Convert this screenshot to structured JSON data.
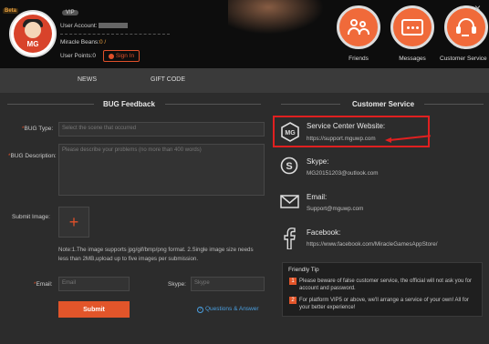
{
  "header": {
    "beta_label": "Beta",
    "vip_label": "VIP",
    "user_account_label": "User Account:",
    "miracle_beans_label": "Miracle Beans:",
    "miracle_beans_value": "0 /",
    "user_points_label": "User Points:",
    "user_points_value": "0",
    "sign_in_label": "Sign In",
    "avatar_text": "MG",
    "buttons": [
      {
        "label": "Friends",
        "icon": "friends-icon"
      },
      {
        "label": "Messages",
        "icon": "messages-icon"
      },
      {
        "label": "Customer Service",
        "icon": "headset-icon"
      }
    ],
    "close_glyph": "×"
  },
  "tabs": [
    {
      "label": "NEWS"
    },
    {
      "label": "GIFT CODE"
    }
  ],
  "bug_feedback": {
    "title": "BUG Feedback",
    "bug_type_label": "BUG Type:",
    "bug_type_placeholder": "Select the scene that occurred",
    "bug_description_label": "BUG Description:",
    "bug_description_placeholder": "Please describe your problems (no more than 400 words)",
    "submit_image_label": "Submit Image:",
    "upload_glyph": "+",
    "note": "Note:1.The image supports jpg/gif/bmp/png format.      2.Single image size needs less than 2MB,upload up to five images per submission.",
    "email_label": "Email:",
    "email_placeholder": "Email",
    "skype_label": "Skype:",
    "skype_placeholder": "Skype",
    "submit_label": "Submit",
    "qa_label": "Questions & Answer",
    "required_mark": "*"
  },
  "customer_service": {
    "title": "Customer Service",
    "website_title": "Service Center Website:",
    "website_value": "https://support.mguwp.com",
    "skype_title": "Skype:",
    "skype_value": "MG20151203@outlook.com",
    "email_title": "Email:",
    "email_value": "Support@mguwp.com",
    "facebook_title": "Facebook:",
    "facebook_value": "https://www.facebook.com/MiracleGamesAppStore/",
    "tip_title": "Friendly Tip",
    "tips": [
      {
        "num": "1",
        "text": "Please beware of false customer service, the official will not ask you for account and password."
      },
      {
        "num": "2",
        "text": "For platform VIP5 or above, we'll arrange a service of your own! All for your better experience!"
      }
    ],
    "highlight_color": "#e02020"
  },
  "colors": {
    "accent": "#e2552a",
    "link": "#4a9fe0",
    "background": "#2c2c2c"
  }
}
